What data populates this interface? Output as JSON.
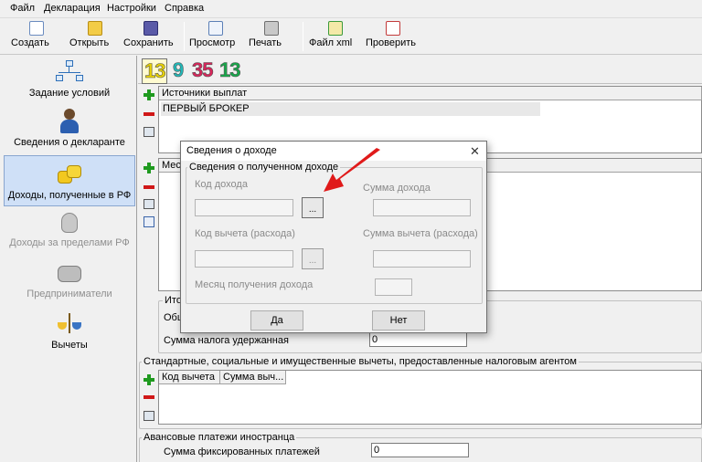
{
  "menu": [
    "Файл",
    "Декларация",
    "Настройки",
    "Справка"
  ],
  "toolbar": {
    "create": "Создать",
    "open": "Открыть",
    "save": "Сохранить",
    "preview": "Просмотр",
    "print": "Печать",
    "xml": "Файл xml",
    "check": "Проверить"
  },
  "nav": {
    "conditions": "Задание условий",
    "declarant": "Сведения о декларанте",
    "income_rf": "Доходы, полученные в РФ",
    "income_abroad": "Доходы за пределами РФ",
    "entrepreneurs": "Предприниматели",
    "deductions": "Вычеты"
  },
  "rates": [
    "13",
    "9",
    "35",
    "13"
  ],
  "sources": {
    "header": "Источники выплат",
    "rows": [
      "ПЕРВЫЙ БРОКЕР"
    ]
  },
  "months_header_partial": "Мес",
  "totals": {
    "title_partial": "Ито",
    "general_partial": "Общ",
    "withheld_label": "Сумма налога удержанная",
    "withheld_value": "0"
  },
  "standard_deductions": {
    "title": "Стандартные, социальные и имущественные вычеты, предоставленные налоговым агентом",
    "col_code": "Код вычета",
    "col_sum": "Сумма выч..."
  },
  "advance": {
    "title": "Авансовые платежи иностранца",
    "fixed_label": "Сумма фиксированных платежей",
    "fixed_value": "0"
  },
  "dialog": {
    "title": "Сведения о доходе",
    "close": "✕",
    "group_title": "Сведения о полученном доходе",
    "income_code": "Код дохода",
    "income_sum": "Сумма дохода",
    "deduction_code": "Код вычета (расхода)",
    "deduction_sum": "Сумма вычета (расхода)",
    "month": "Месяц получения дохода",
    "ellipsis": "...",
    "yes": "Да",
    "no": "Нет"
  },
  "colors": {
    "accent_arrow": "#e01a1a",
    "selected_nav": "#cfe0f7",
    "rate_yellow": "#e8d200",
    "rate_cyan": "#22b7b7",
    "rate_red": "#d8255a",
    "rate_green": "#17a84a"
  }
}
